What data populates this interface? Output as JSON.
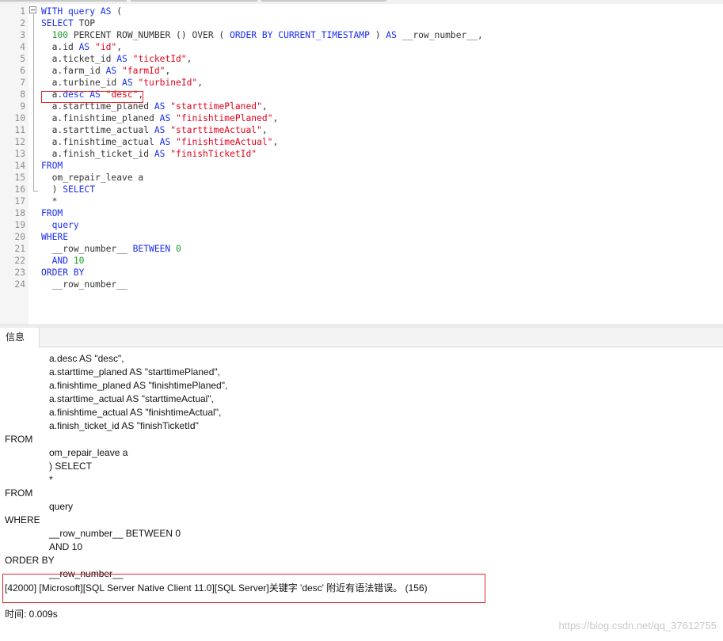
{
  "editor": {
    "lines": [
      {
        "n": "1",
        "segs": [
          [
            "kw",
            "WITH query AS"
          ],
          [
            "p",
            " ("
          ]
        ]
      },
      {
        "n": "2",
        "segs": [
          [
            "kw",
            "SELECT"
          ],
          [
            "p",
            " TOP"
          ]
        ]
      },
      {
        "n": "3",
        "segs": [
          [
            "p",
            "  "
          ],
          [
            "num",
            "100"
          ],
          [
            "p",
            " PERCENT ROW_NUMBER () OVER ( "
          ],
          [
            "kw",
            "ORDER BY CURRENT_TIMESTAMP"
          ],
          [
            "p",
            " ) "
          ],
          [
            "kw",
            "AS"
          ],
          [
            "p",
            " __row_number__,"
          ]
        ]
      },
      {
        "n": "4",
        "segs": [
          [
            "p",
            "  a.id "
          ],
          [
            "kw",
            "AS"
          ],
          [
            "p",
            " "
          ],
          [
            "str",
            "\"id\""
          ],
          [
            "p",
            ","
          ]
        ]
      },
      {
        "n": "5",
        "segs": [
          [
            "p",
            "  a.ticket_id "
          ],
          [
            "kw",
            "AS"
          ],
          [
            "p",
            " "
          ],
          [
            "str",
            "\"ticketId\""
          ],
          [
            "p",
            ","
          ]
        ]
      },
      {
        "n": "6",
        "segs": [
          [
            "p",
            "  a.farm_id "
          ],
          [
            "kw",
            "AS"
          ],
          [
            "p",
            " "
          ],
          [
            "str",
            "\"farmId\""
          ],
          [
            "p",
            ","
          ]
        ]
      },
      {
        "n": "7",
        "segs": [
          [
            "p",
            "  a.turbine_id "
          ],
          [
            "kw",
            "AS"
          ],
          [
            "p",
            " "
          ],
          [
            "str",
            "\"turbineId\""
          ],
          [
            "p",
            ","
          ]
        ]
      },
      {
        "n": "8",
        "segs": [
          [
            "p",
            "  a."
          ],
          [
            "kw",
            "desc AS"
          ],
          [
            "p",
            " "
          ],
          [
            "str",
            "\"desc\""
          ],
          [
            "p",
            ","
          ]
        ]
      },
      {
        "n": "9",
        "segs": [
          [
            "p",
            "  a.starttime_planed "
          ],
          [
            "kw",
            "AS"
          ],
          [
            "p",
            " "
          ],
          [
            "str",
            "\"starttimePlaned\""
          ],
          [
            "p",
            ","
          ]
        ]
      },
      {
        "n": "10",
        "segs": [
          [
            "p",
            "  a.finishtime_planed "
          ],
          [
            "kw",
            "AS"
          ],
          [
            "p",
            " "
          ],
          [
            "str",
            "\"finishtimePlaned\""
          ],
          [
            "p",
            ","
          ]
        ]
      },
      {
        "n": "11",
        "segs": [
          [
            "p",
            "  a.starttime_actual "
          ],
          [
            "kw",
            "AS"
          ],
          [
            "p",
            " "
          ],
          [
            "str",
            "\"starttimeActual\""
          ],
          [
            "p",
            ","
          ]
        ]
      },
      {
        "n": "12",
        "segs": [
          [
            "p",
            "  a.finishtime_actual "
          ],
          [
            "kw",
            "AS"
          ],
          [
            "p",
            " "
          ],
          [
            "str",
            "\"finishtimeActual\""
          ],
          [
            "p",
            ","
          ]
        ]
      },
      {
        "n": "13",
        "segs": [
          [
            "p",
            "  a.finish_ticket_id "
          ],
          [
            "kw",
            "AS"
          ],
          [
            "p",
            " "
          ],
          [
            "str",
            "\"finishTicketId\""
          ]
        ]
      },
      {
        "n": "14",
        "segs": [
          [
            "kw",
            "FROM"
          ]
        ]
      },
      {
        "n": "15",
        "segs": [
          [
            "p",
            "  om_repair_leave a"
          ]
        ]
      },
      {
        "n": "16",
        "segs": [
          [
            "p",
            "  ) "
          ],
          [
            "kw",
            "SELECT"
          ]
        ]
      },
      {
        "n": "17",
        "segs": [
          [
            "p",
            "  *"
          ]
        ]
      },
      {
        "n": "18",
        "segs": [
          [
            "kw",
            "FROM"
          ]
        ]
      },
      {
        "n": "19",
        "segs": [
          [
            "p",
            "  "
          ],
          [
            "kw",
            "query"
          ]
        ]
      },
      {
        "n": "20",
        "segs": [
          [
            "kw",
            "WHERE"
          ]
        ]
      },
      {
        "n": "21",
        "segs": [
          [
            "p",
            "  __row_number__ "
          ],
          [
            "kw",
            "BETWEEN"
          ],
          [
            "p",
            " "
          ],
          [
            "num",
            "0"
          ]
        ]
      },
      {
        "n": "22",
        "segs": [
          [
            "p",
            "  "
          ],
          [
            "kw",
            "AND"
          ],
          [
            "p",
            " "
          ],
          [
            "num",
            "10"
          ]
        ]
      },
      {
        "n": "23",
        "segs": [
          [
            "kw",
            "ORDER BY"
          ]
        ]
      },
      {
        "n": "24",
        "segs": [
          [
            "p",
            "  __row_number__"
          ]
        ]
      }
    ]
  },
  "messages": {
    "tab_label": "信息",
    "lines": [
      {
        "indent": true,
        "text": "a.desc AS \"desc\","
      },
      {
        "indent": true,
        "text": "a.starttime_planed AS \"starttimePlaned\","
      },
      {
        "indent": true,
        "text": "a.finishtime_planed AS \"finishtimePlaned\","
      },
      {
        "indent": true,
        "text": "a.starttime_actual AS \"starttimeActual\","
      },
      {
        "indent": true,
        "text": "a.finishtime_actual AS \"finishtimeActual\","
      },
      {
        "indent": true,
        "text": "a.finish_ticket_id AS \"finishTicketId\""
      },
      {
        "indent": false,
        "text": "FROM"
      },
      {
        "indent": true,
        "text": "om_repair_leave a"
      },
      {
        "indent": true,
        "text": ") SELECT"
      },
      {
        "indent": true,
        "text": "*"
      },
      {
        "indent": false,
        "text": "FROM"
      },
      {
        "indent": true,
        "text": "query"
      },
      {
        "indent": false,
        "text": "WHERE"
      },
      {
        "indent": true,
        "text": "__row_number__ BETWEEN 0"
      },
      {
        "indent": true,
        "text": "AND 10"
      },
      {
        "indent": false,
        "text": "ORDER BY"
      },
      {
        "indent": true,
        "text": "__row_number__"
      }
    ],
    "error": "[42000] [Microsoft][SQL Server Native Client 11.0][SQL Server]关键字 'desc' 附近有语法错误。 (156)",
    "time": "时间: 0.009s"
  },
  "watermark": "https://blog.csdn.net/qq_37612755",
  "colors": {
    "keyword": "#1a2df0",
    "string": "#e0001c",
    "number": "#1a9c2e",
    "highlight_border": "#e3262b"
  }
}
